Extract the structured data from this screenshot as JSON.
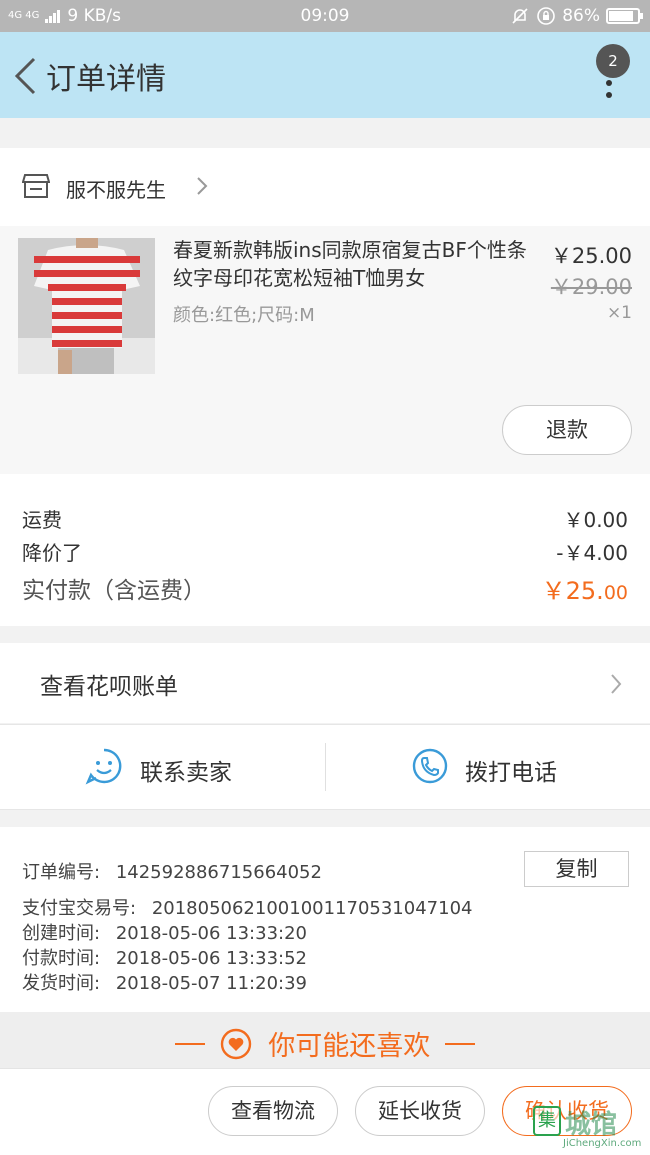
{
  "status_bar": {
    "network": "4G 4G",
    "speed": "9 KB/s",
    "time": "09:09",
    "battery_text": "86%",
    "battery_level": 0.86
  },
  "nav": {
    "title": "订单详情",
    "badge_count": "2"
  },
  "shop": {
    "name": "服不服先生"
  },
  "product": {
    "title": "春夏新款韩版ins同款原宿复古BF个性条纹字母印花宽松短袖T恤男女",
    "spec": "颜色:红色;尺码:M",
    "price": "￥25.00",
    "original_price": "￥29.00",
    "quantity": "×1",
    "refund_label": "退款"
  },
  "fees": {
    "shipping_label": "运费",
    "shipping_value": "￥0.00",
    "discount_label": "降价了",
    "discount_value": "-￥4.00",
    "paid_label": "实付款（含运费）",
    "paid_value_main": "￥25.",
    "paid_value_cents": "00"
  },
  "huabei": {
    "label": "查看花呗账单"
  },
  "contact": {
    "seller_label": "联系卖家",
    "phone_label": "拨打电话"
  },
  "order_info": {
    "order_no_label": "订单编号:",
    "order_no": "142592886715664052",
    "copy_label": "复制",
    "alipay_label": "支付宝交易号:",
    "alipay_no": "2018050621001001170531047104",
    "created_label": "创建时间:",
    "created": "2018-05-06 13:33:20",
    "paid_label": "付款时间:",
    "paid": "2018-05-06 13:33:52",
    "shipped_label": "发货时间:",
    "shipped": "2018-05-07 11:20:39"
  },
  "may_like": {
    "label": "你可能还喜欢"
  },
  "actions": {
    "logistics": "查看物流",
    "extend": "延长收货",
    "confirm": "确认收货"
  },
  "watermark": {
    "logo_char": "集",
    "cn": "城馆",
    "en": "JiChengXin.com"
  },
  "colors": {
    "accent": "#f36c1e",
    "nav_bg": "#bde4f4",
    "icon_blue": "#3a9bd8"
  }
}
